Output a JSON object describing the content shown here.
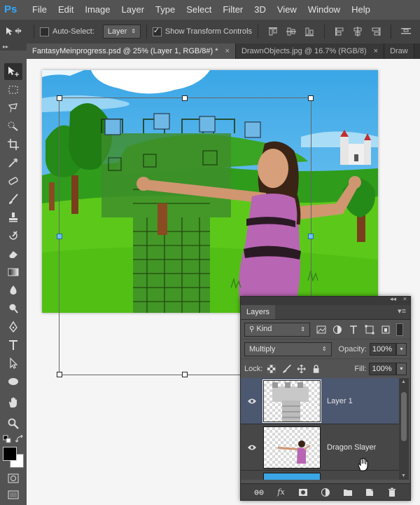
{
  "app": {
    "logo": "Ps"
  },
  "menu": {
    "items": [
      "File",
      "Edit",
      "Image",
      "Layer",
      "Type",
      "Select",
      "Filter",
      "3D",
      "View",
      "Window",
      "Help"
    ]
  },
  "options": {
    "auto_select_label": "Auto-Select:",
    "auto_select_checked": false,
    "auto_select_target": "Layer",
    "show_transform_label": "Show Transform Controls",
    "show_transform_checked": true
  },
  "tabs": [
    {
      "label": "FantasyMeinprogress.psd @ 25% (Layer 1, RGB/8#) *",
      "active": true
    },
    {
      "label": "DrawnObjects.jpg @ 16.7% (RGB/8)",
      "active": false
    },
    {
      "label": "Draw",
      "active": false
    }
  ],
  "tools": [
    "move-tool",
    "marquee-tool",
    "lasso-tool",
    "quick-select-tool",
    "crop-tool",
    "eyedropper-tool",
    "healing-brush-tool",
    "brush-tool",
    "clone-stamp-tool",
    "history-brush-tool",
    "eraser-tool",
    "gradient-tool",
    "blur-tool",
    "dodge-tool",
    "pen-tool",
    "type-tool",
    "path-selection-tool",
    "ellipse-tool",
    "hand-tool",
    "zoom-tool"
  ],
  "colors": {
    "foreground": "#000000",
    "background": "#ffffff",
    "accent": "#31a8ff",
    "selected_layer": "#4c5770"
  },
  "layers_panel": {
    "tab_label": "Layers",
    "filter_kind": "Kind",
    "blend_mode": "Multiply",
    "opacity_label": "Opacity:",
    "opacity_value": "100%",
    "lock_label": "Lock:",
    "fill_label": "Fill:",
    "fill_value": "100%",
    "layers": [
      {
        "name": "Layer 1",
        "visible": true,
        "selected": true
      },
      {
        "name": "Dragon Slayer",
        "visible": true,
        "selected": false
      }
    ]
  }
}
